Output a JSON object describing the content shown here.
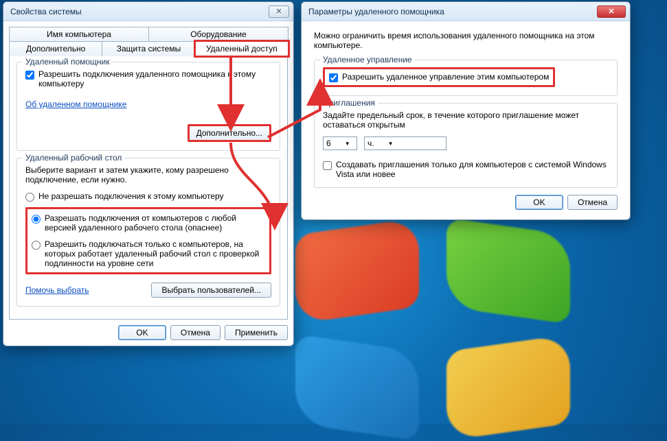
{
  "win1": {
    "title": "Свойства системы",
    "tabs": {
      "row1": [
        "Имя компьютера",
        "Оборудование"
      ],
      "row2": [
        "Дополнительно",
        "Защита системы",
        "Удаленный доступ"
      ],
      "selected": "Удаленный доступ"
    },
    "ra_group": {
      "legend": "Удаленный помощник",
      "allow_label": "Разрешить подключения удаленного помощника к этому компьютеру",
      "about_link": "Об удаленном помощнике",
      "advanced_btn": "Дополнительно..."
    },
    "rdp_group": {
      "legend": "Удаленный рабочий стол",
      "hint": "Выберите вариант и затем укажите, кому разрешено подключение, если нужно.",
      "opt1": "Не разрешать подключения к этому компьютеру",
      "opt2": "Разрешать подключения от компьютеров с любой версией удаленного рабочего стола (опаснее)",
      "opt3": "Разрешить подключаться только с компьютеров, на которых работает удаленный рабочий стол с проверкой подлинности на уровне сети",
      "help_link": "Помочь выбрать",
      "select_users_btn": "Выбрать пользователей..."
    },
    "buttons": {
      "ok": "OK",
      "cancel": "Отмена",
      "apply": "Применить"
    }
  },
  "win2": {
    "title": "Параметры удаленного помощника",
    "intro": "Можно ограничить время использования удаленного помощника на этом компьютере.",
    "rc_group": {
      "legend": "Удаленное управление",
      "allow_label": "Разрешить удаленное управление этим компьютером"
    },
    "inv_group": {
      "legend": "Приглашения",
      "hint": "Задайте предельный срок, в течение которого приглашение может оставаться открытым",
      "value": "6",
      "unit": "ч.",
      "vista_label": "Создавать приглашения только для компьютеров с системой Windows Vista или новее"
    },
    "buttons": {
      "ok": "OK",
      "cancel": "Отмена"
    }
  }
}
